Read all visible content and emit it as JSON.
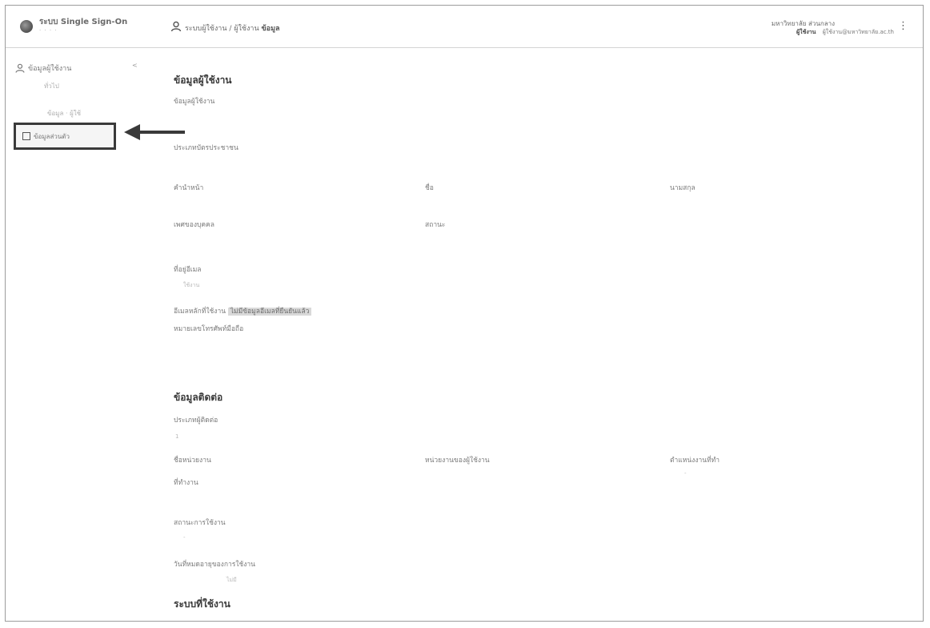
{
  "header": {
    "app_title": "ระบบ Single Sign-On",
    "app_subtitle": "· · · ·",
    "breadcrumb_prefix": "ระบบผู้ใช้งาน /",
    "breadcrumb_middle": "ผู้ใช้งาน",
    "breadcrumb_last": "ข้อมูล",
    "user_org": "มหาวิทยาลัย ส่วนกลาง",
    "user_name": "ผู้ใช้งาน",
    "user_email": "ผู้ใช้งาน@มหาวิทยาลัย.ac.th"
  },
  "sidebar": {
    "section_label": "ข้อมูลผู้ใช้งาน",
    "chevron": "<",
    "item_1": "ทั่วไป",
    "item_2": "ข้อมูล · ผู้ใช้",
    "active_item": "ข้อมูลส่วนตัว"
  },
  "profile": {
    "section_title": "ข้อมูลผู้ใช้งาน",
    "subtitle": "ข้อมูลผู้ใช้งาน",
    "id_type_label": "ประเภทบัตรประชาชน",
    "prefix_label": "คำนำหน้า",
    "firstname_label": "ชื่อ",
    "lastname_label": "นามสกุล",
    "gender_label": "เพศของบุคคล",
    "status_label": "สถานะ",
    "status_sub": "ใช้งาน",
    "email_label": "ที่อยู่อีเมล",
    "email_label_full": "อีเมลหลักที่ใช้งาน",
    "email_value": "ไม่มีข้อมูลอีเมลที่ยืนยันแล้ว",
    "phone_label": "หมายเลขโทรศัพท์มือถือ"
  },
  "contact": {
    "section_title": "ข้อมูลติดต่อ",
    "subtitle": "ประเภทผู้ติดต่อ",
    "id_value": "1",
    "office_label": "ชื่อหน่วยงาน",
    "unit_label": "หน่วยงานของผู้ใช้งาน",
    "position_label": "ตำแหน่งงานที่ทำ",
    "position_value": "-",
    "location_label": "ที่ทำงาน",
    "work_label": "สถานะการใช้งาน",
    "work_value": "-",
    "expire_label": "วันที่หมดอายุของการใช้งาน",
    "expire_value": "ไม่มี"
  },
  "footer_section": {
    "title": "ระบบที่ใช้งาน"
  }
}
